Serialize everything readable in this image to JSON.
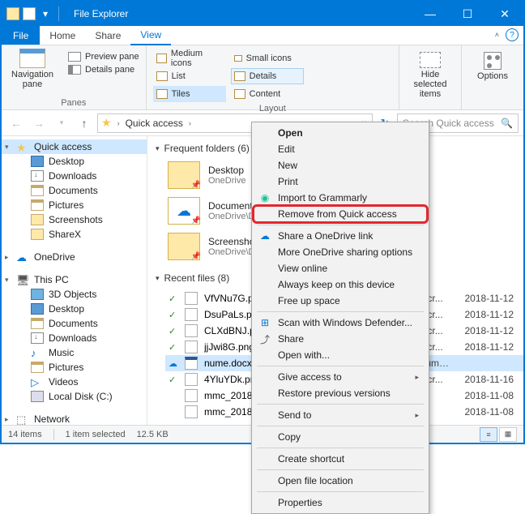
{
  "title": "File Explorer",
  "tabs": {
    "file": "File",
    "home": "Home",
    "share": "Share",
    "view": "View"
  },
  "ribbon": {
    "navpane": "Navigation\npane",
    "preview": "Preview pane",
    "details": "Details pane",
    "panes_label": "Panes",
    "layout_label": "Layout",
    "layout": {
      "medium": "Medium icons",
      "small": "Small icons",
      "list": "List",
      "details": "Details",
      "tiles": "Tiles",
      "content": "Content"
    },
    "hide": "Hide selected\nitems",
    "options": "Options"
  },
  "address": {
    "location": "Quick access",
    "search_placeholder": "Search Quick access"
  },
  "sidebar": {
    "quick": "Quick access",
    "desktop": "Desktop",
    "downloads": "Downloads",
    "documents": "Documents",
    "pictures": "Pictures",
    "screenshots": "Screenshots",
    "sharex": "ShareX",
    "onedrive": "OneDrive",
    "thispc": "This PC",
    "objects3d": "3D Objects",
    "desktop2": "Desktop",
    "documents2": "Documents",
    "downloads2": "Downloads",
    "music": "Music",
    "pictures2": "Pictures",
    "videos": "Videos",
    "localdisk": "Local Disk (C:)",
    "network": "Network"
  },
  "sections": {
    "frequent": "Frequent folders (6)",
    "recent": "Recent files (8)"
  },
  "folders": [
    {
      "name": "Desktop",
      "sub": "OneDrive"
    },
    {
      "name": "Documents",
      "sub": "OneDrive\\D"
    },
    {
      "name": "Screenshots",
      "sub": "OneDrive\\D"
    }
  ],
  "recent": [
    {
      "name": "VfVNu7G.png",
      "path": "ents\\ShareX\\Scr...",
      "date": "2018-11-12"
    },
    {
      "name": "DsuPaLs.png",
      "path": "ents\\ShareX\\Scr...",
      "date": "2018-11-12"
    },
    {
      "name": "CLXdBNJ.png",
      "path": "ents\\ShareX\\Scr...",
      "date": "2018-11-12"
    },
    {
      "name": "jjJwi8G.png",
      "path": "ents\\ShareX\\Scr...",
      "date": "2018-11-12"
    },
    {
      "name": "nume.docx",
      "path": "OneDrive\\Documents\\Cadouri",
      "date": ""
    },
    {
      "name": "4YluYDk.png",
      "path": "ents\\ShareX\\Scr...",
      "date": "2018-11-16"
    },
    {
      "name": "mmc_2018-11-08_17-14-04.png",
      "path": "",
      "date": "2018-11-08"
    },
    {
      "name": "mmc_2018-11-08_17-09-19.png",
      "path": "",
      "date": "2018-11-08"
    }
  ],
  "ctx": {
    "open": "Open",
    "edit": "Edit",
    "new": "New",
    "print": "Print",
    "grammarly": "Import to Grammarly",
    "remove_qa": "Remove from Quick access",
    "share_od": "Share a OneDrive link",
    "more_od": "More OneDrive sharing options",
    "view_online": "View online",
    "keep_device": "Always keep on this device",
    "free_space": "Free up space",
    "defender": "Scan with Windows Defender...",
    "share": "Share",
    "open_with": "Open with...",
    "give_access": "Give access to",
    "restore": "Restore previous versions",
    "send_to": "Send to",
    "copy": "Copy",
    "shortcut": "Create shortcut",
    "open_loc": "Open file location",
    "properties": "Properties"
  },
  "status": {
    "items": "14 items",
    "selected": "1 item selected",
    "size": "12.5 KB"
  }
}
